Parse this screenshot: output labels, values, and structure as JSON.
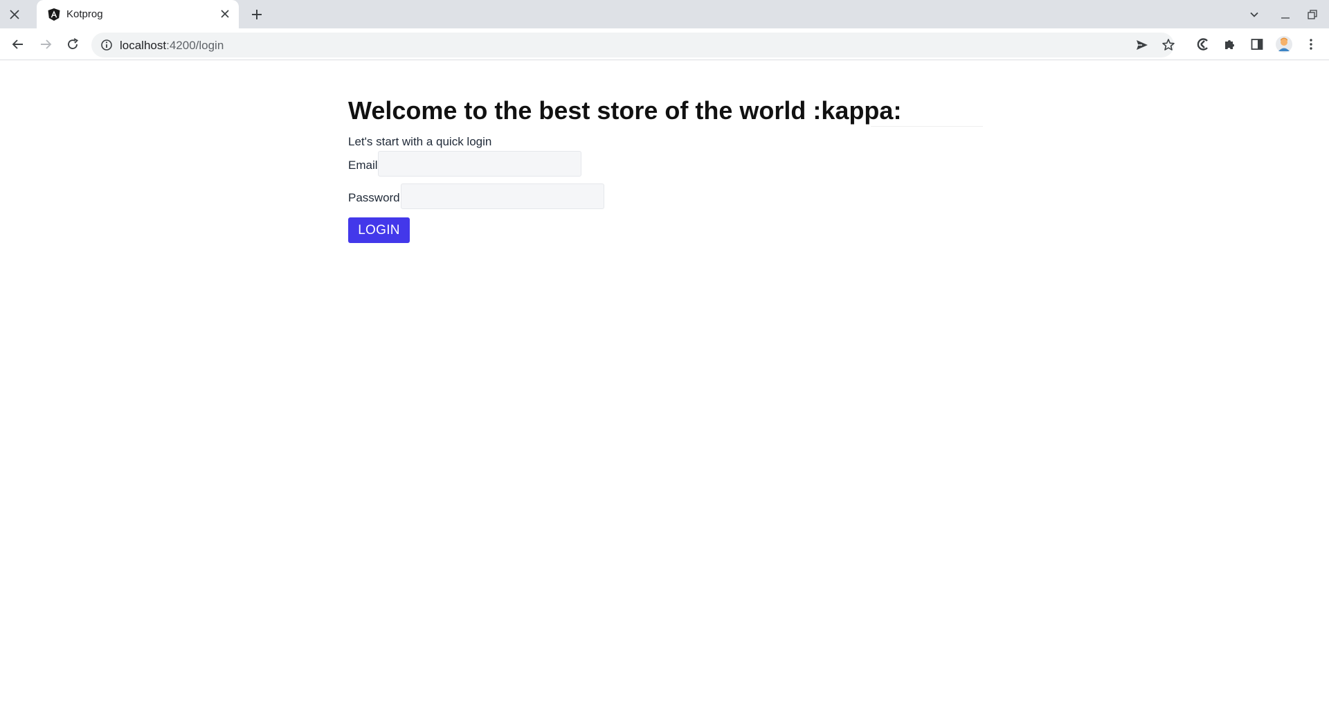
{
  "browser": {
    "tab": {
      "title": "Kotprog",
      "favicon": "angular-icon"
    },
    "omnibox": {
      "host": "localhost",
      "path": ":4200/login"
    }
  },
  "page": {
    "title": "Welcome to the best store of the world :kappa:",
    "subtitle": "Let's start with a quick login",
    "email": {
      "label": "Email",
      "value": ""
    },
    "password": {
      "label": "Password",
      "value": ""
    },
    "login_label": "LOGIN"
  },
  "colors": {
    "tabstrip_bg": "#dee1e6",
    "omnibox_bg": "#f1f3f4",
    "login_button": "#4338ea"
  }
}
